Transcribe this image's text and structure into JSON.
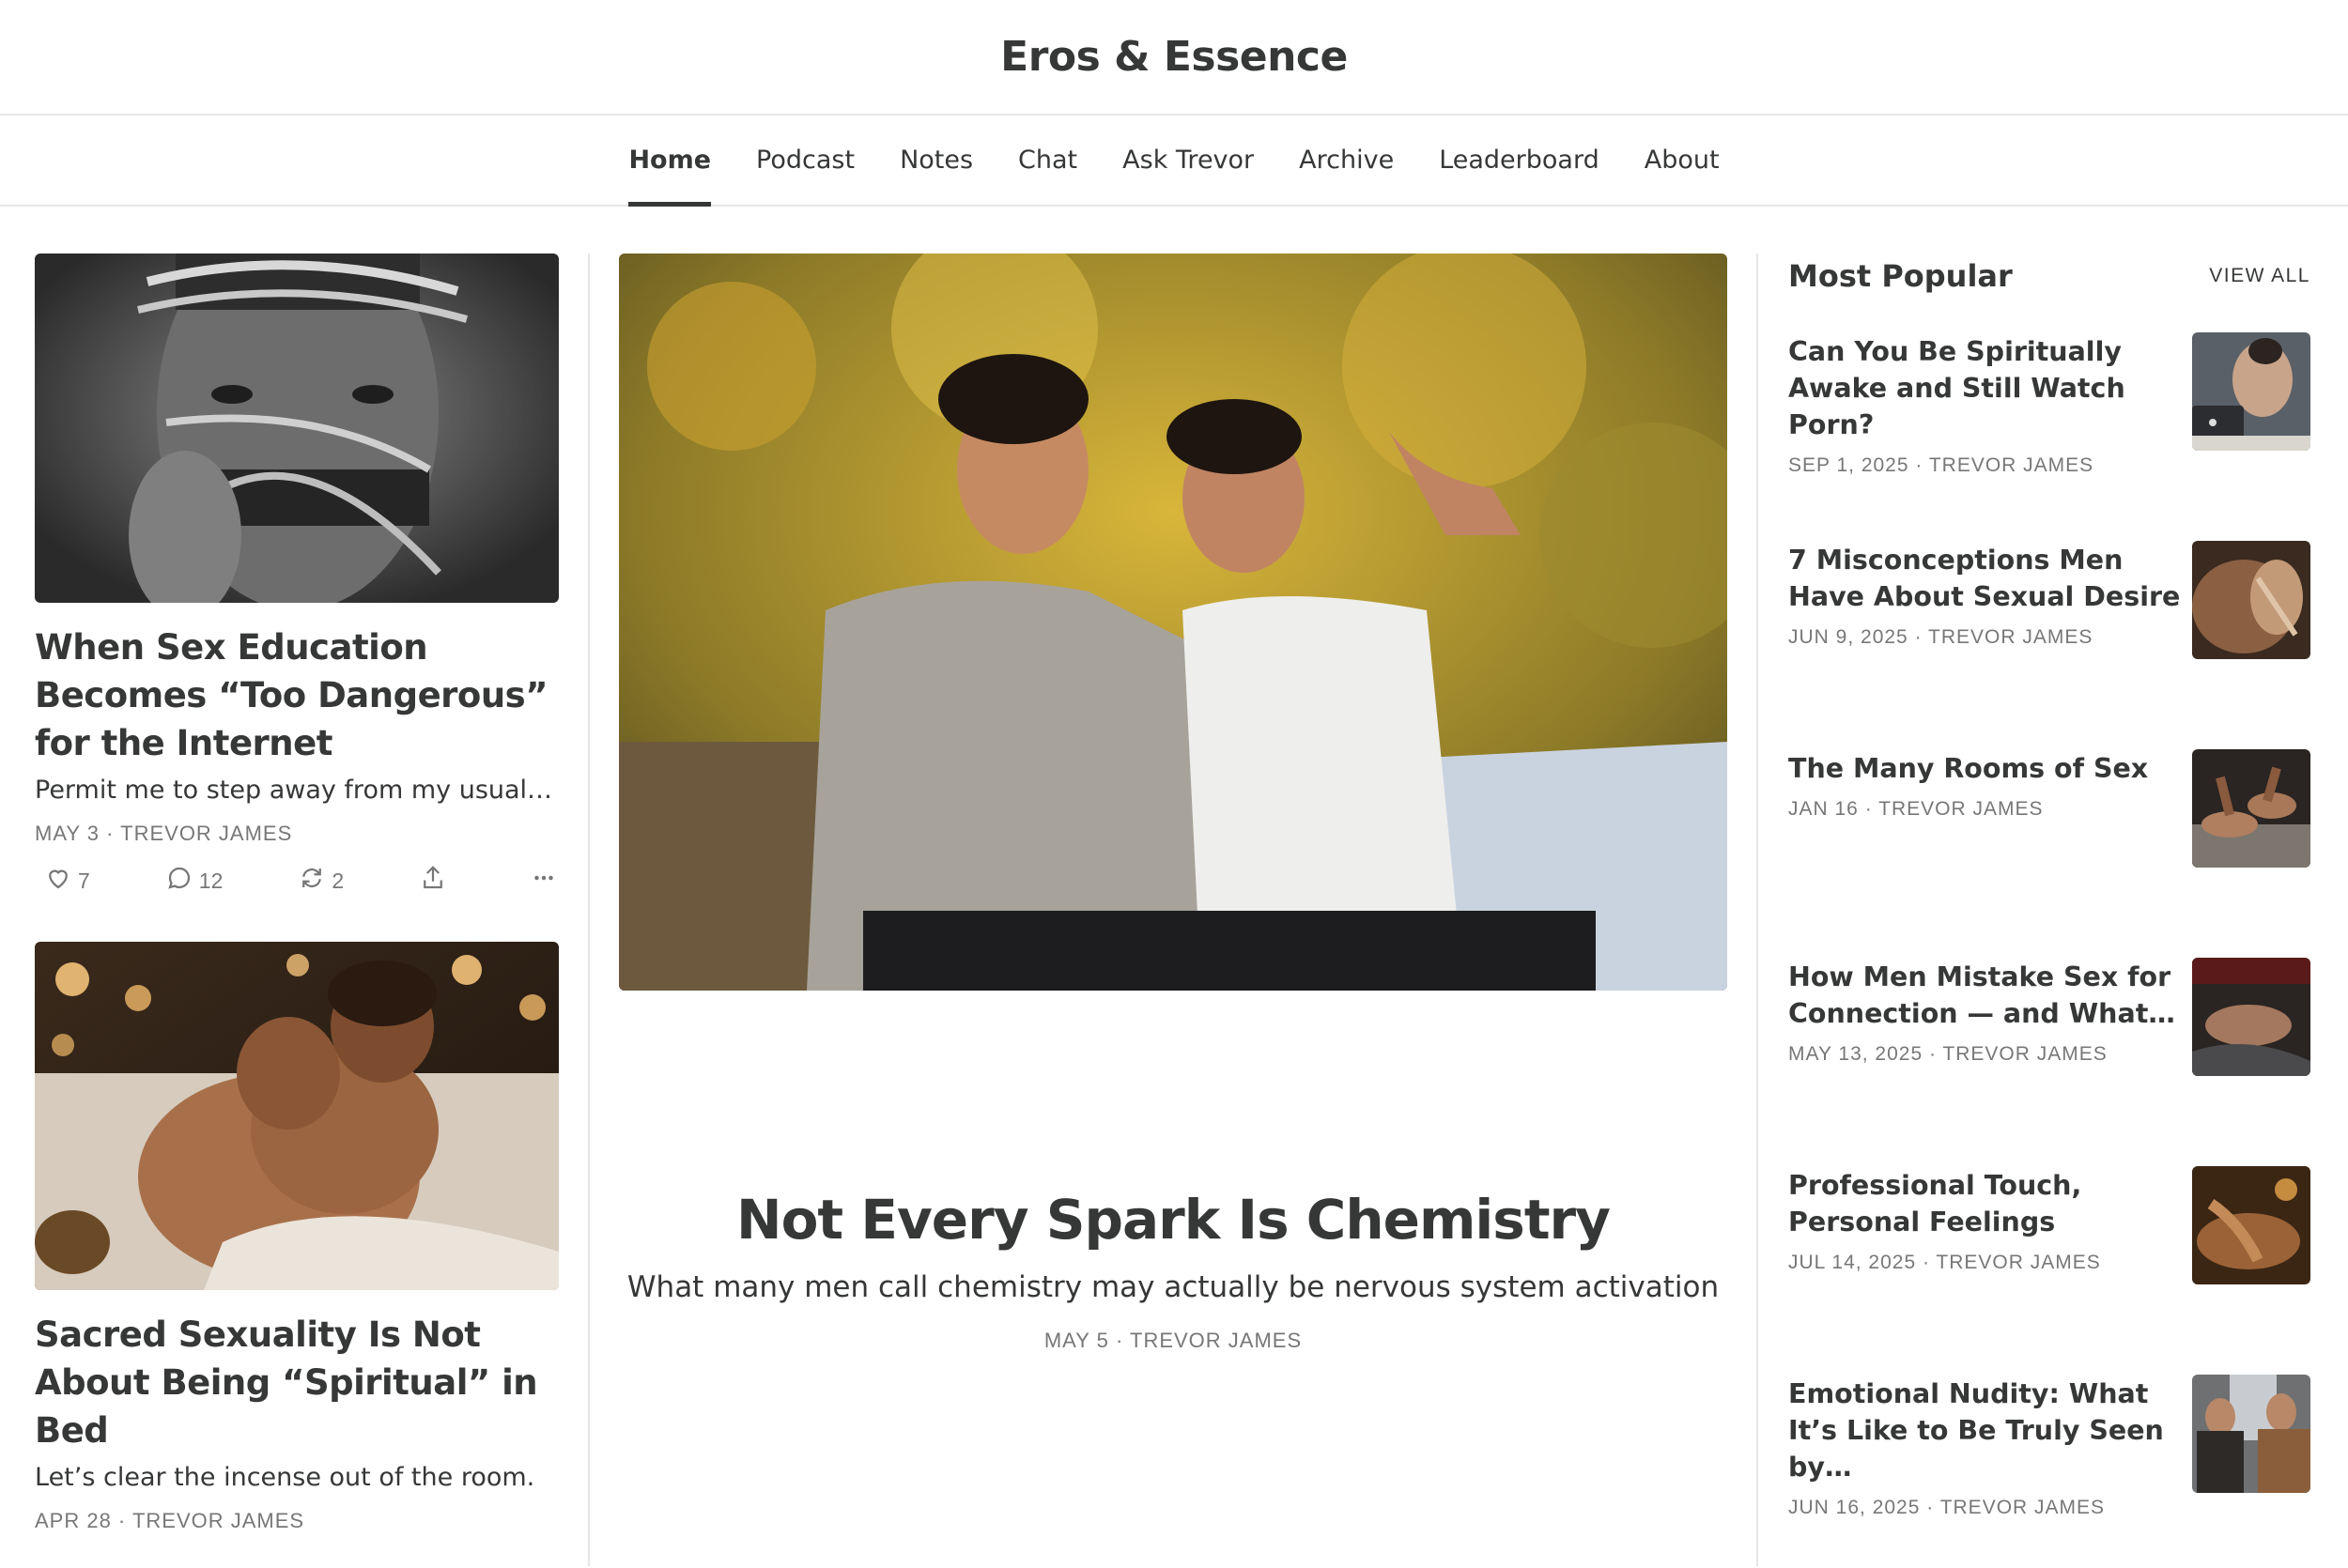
{
  "site": {
    "title": "Eros & Essence"
  },
  "nav": [
    {
      "label": "Home",
      "active": true
    },
    {
      "label": "Podcast"
    },
    {
      "label": "Notes"
    },
    {
      "label": "Chat"
    },
    {
      "label": "Ask Trevor"
    },
    {
      "label": "Archive"
    },
    {
      "label": "Leaderboard"
    },
    {
      "label": "About"
    }
  ],
  "left_posts": [
    {
      "title": "When Sex Education Becomes “Too Dangerous” for the Internet",
      "subtitle": "Permit me to step away from my usual…",
      "meta": "MAY 3 · TREVOR JAMES",
      "likes": "7",
      "comments": "12",
      "restacks": "2"
    },
    {
      "title": "Sacred Sexuality Is Not About Being “Spiritual” in Bed",
      "subtitle": "Let’s clear the incense out of the room.",
      "meta": "APR 28 · TREVOR JAMES"
    }
  ],
  "featured": {
    "title": "Not Every Spark Is Chemistry",
    "subtitle": "What many men call chemistry may actually be nervous system activation",
    "meta": "MAY 5 · TREVOR JAMES"
  },
  "popular": {
    "heading": "Most Popular",
    "view_all": "VIEW ALL",
    "items": [
      {
        "title": "Can You Be Spiritually Awake and Still Watch Porn?",
        "meta": "SEP 1, 2025 · TREVOR JAMES"
      },
      {
        "title": "7 Misconceptions Men Have About Sexual Desire",
        "meta": "JUN 9, 2025 · TREVOR JAMES"
      },
      {
        "title": "The Many Rooms of Sex",
        "meta": "JAN 16 · TREVOR JAMES"
      },
      {
        "title": "How Men Mistake Sex for Connection — and What…",
        "meta": "MAY 13, 2025 · TREVOR JAMES"
      },
      {
        "title": "Professional Touch, Personal Feelings",
        "meta": "JUL 14, 2025 · TREVOR JAMES"
      },
      {
        "title": "Emotional Nudity: What It’s Like to Be Truly Seen by…",
        "meta": "JUN 16, 2025 · TREVOR JAMES"
      }
    ]
  },
  "colors": {
    "text": "#363737",
    "muted": "#777777",
    "border": "#e6e6e6"
  }
}
